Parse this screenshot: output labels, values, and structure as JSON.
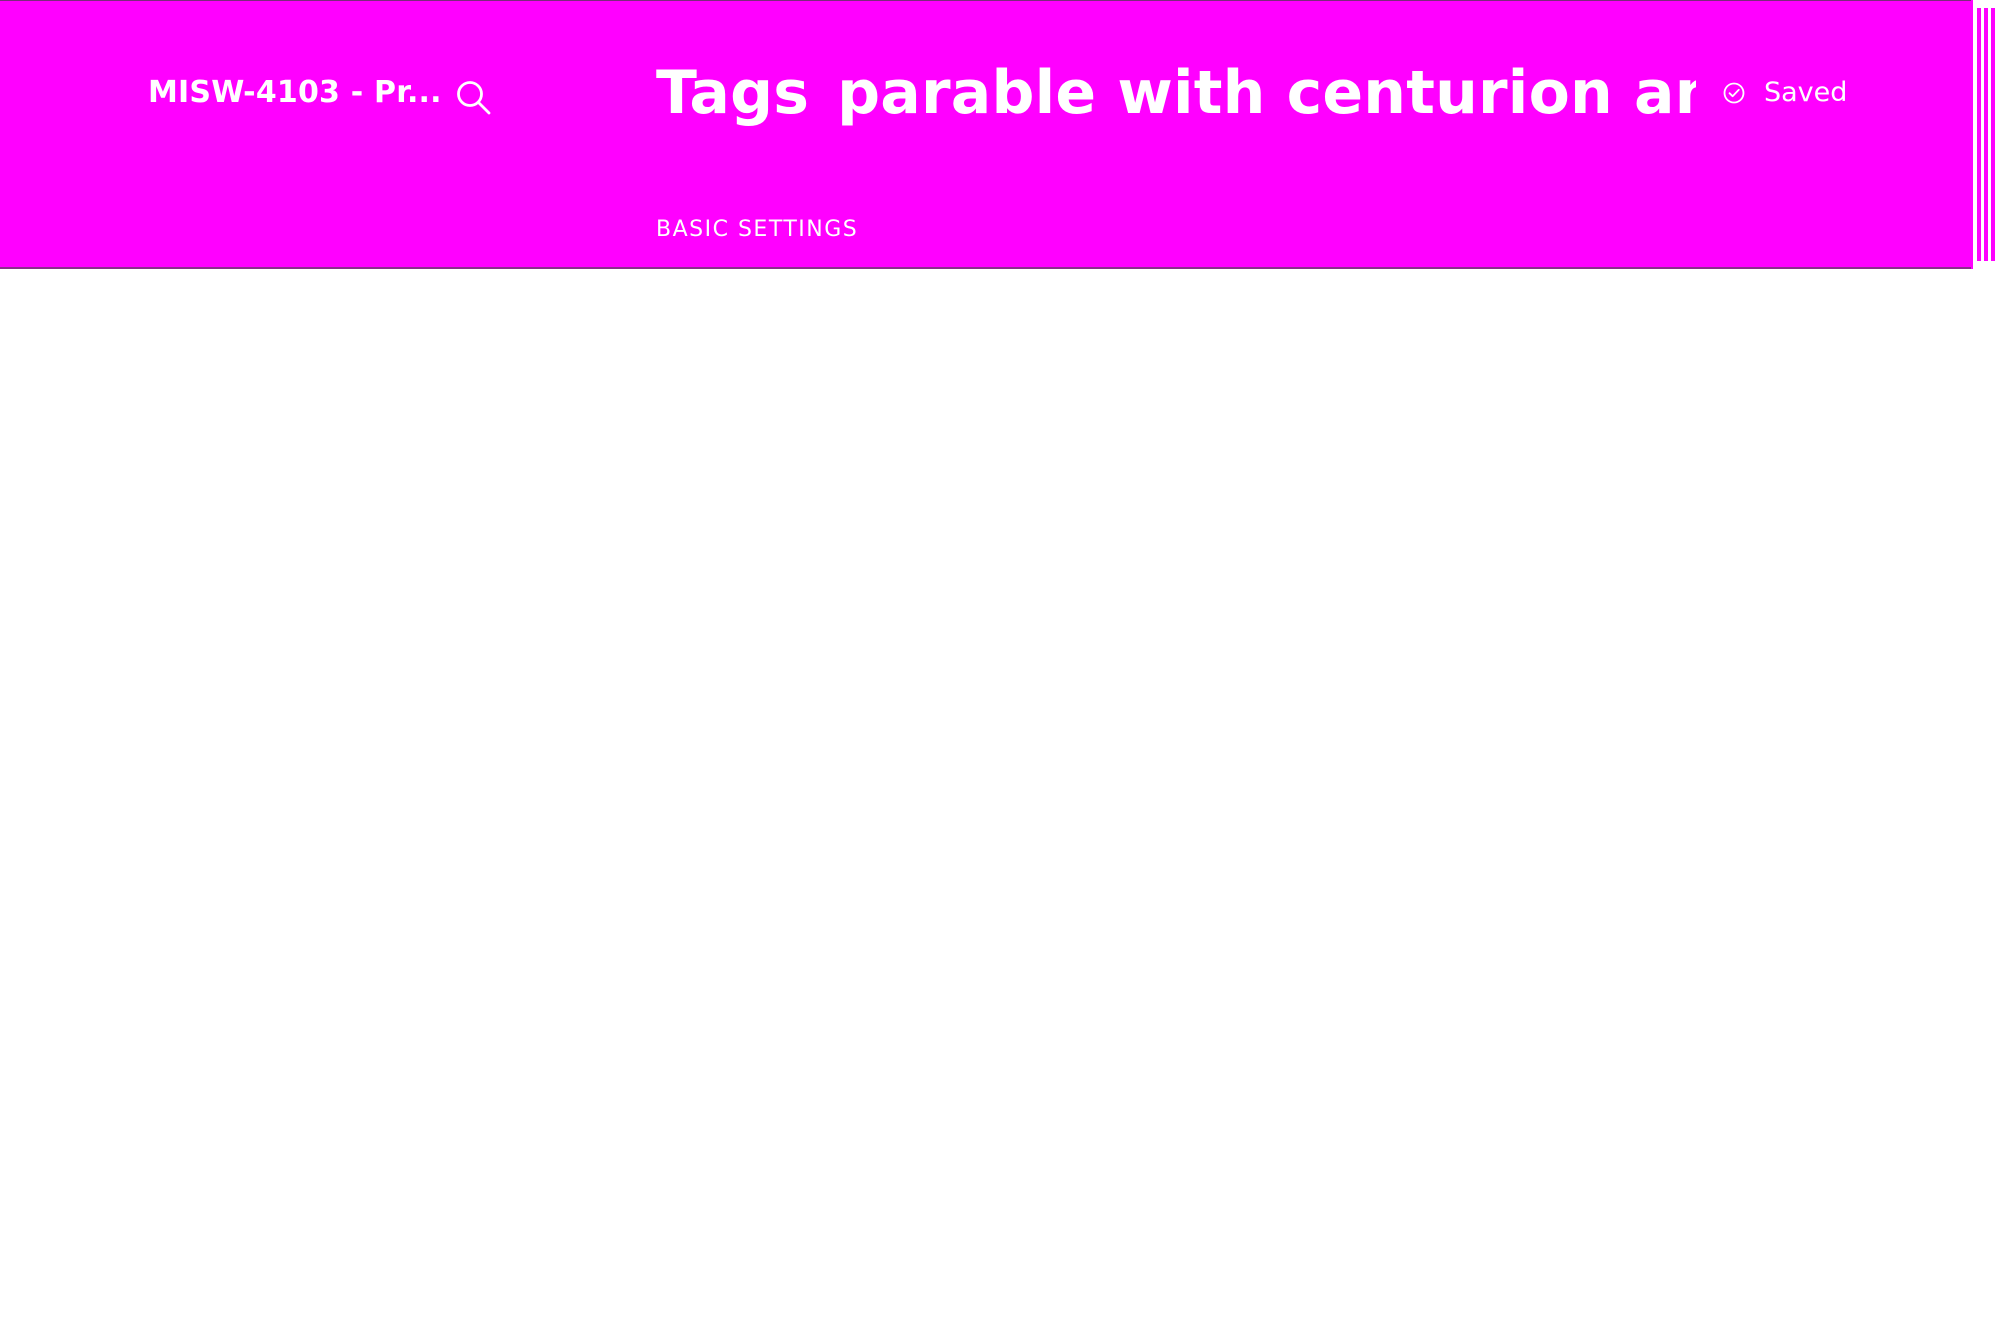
{
  "header": {
    "site_title": "MISW-4103 - Pr...",
    "search_icon": "search-icon",
    "title_prefix": "Tags",
    "title_text": "parable with centurion among",
    "status_icon": "check-circle-icon",
    "status_text": "Saved",
    "section_label": "BASIC SETTINGS"
  },
  "colors": {
    "header_background": "#ff00ff",
    "content_background": "#ffffff",
    "text": "#ffffff"
  }
}
